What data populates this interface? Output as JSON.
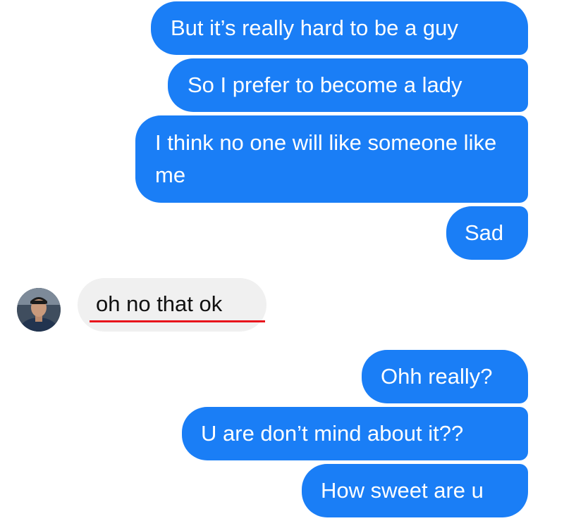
{
  "conversation": {
    "messages": [
      {
        "sender": "me",
        "text": "But it’s really hard to be a guy"
      },
      {
        "sender": "me",
        "text": "So I prefer to become a lady"
      },
      {
        "sender": "me",
        "text": "I think no one will like someone like me"
      },
      {
        "sender": "me",
        "text": "Sad"
      },
      {
        "sender": "other",
        "text": "oh no that ok",
        "underlined": true
      },
      {
        "sender": "me",
        "text": "Ohh really?"
      },
      {
        "sender": "me",
        "text": "U are don’t mind about it??"
      },
      {
        "sender": "me",
        "text": "How sweet are u"
      }
    ]
  },
  "colors": {
    "sent_bubble": "#1a7ef6",
    "received_bubble": "#f0f0f0",
    "underline": "#e8141c"
  },
  "icons": {
    "avatar": "contact-avatar-photo"
  }
}
